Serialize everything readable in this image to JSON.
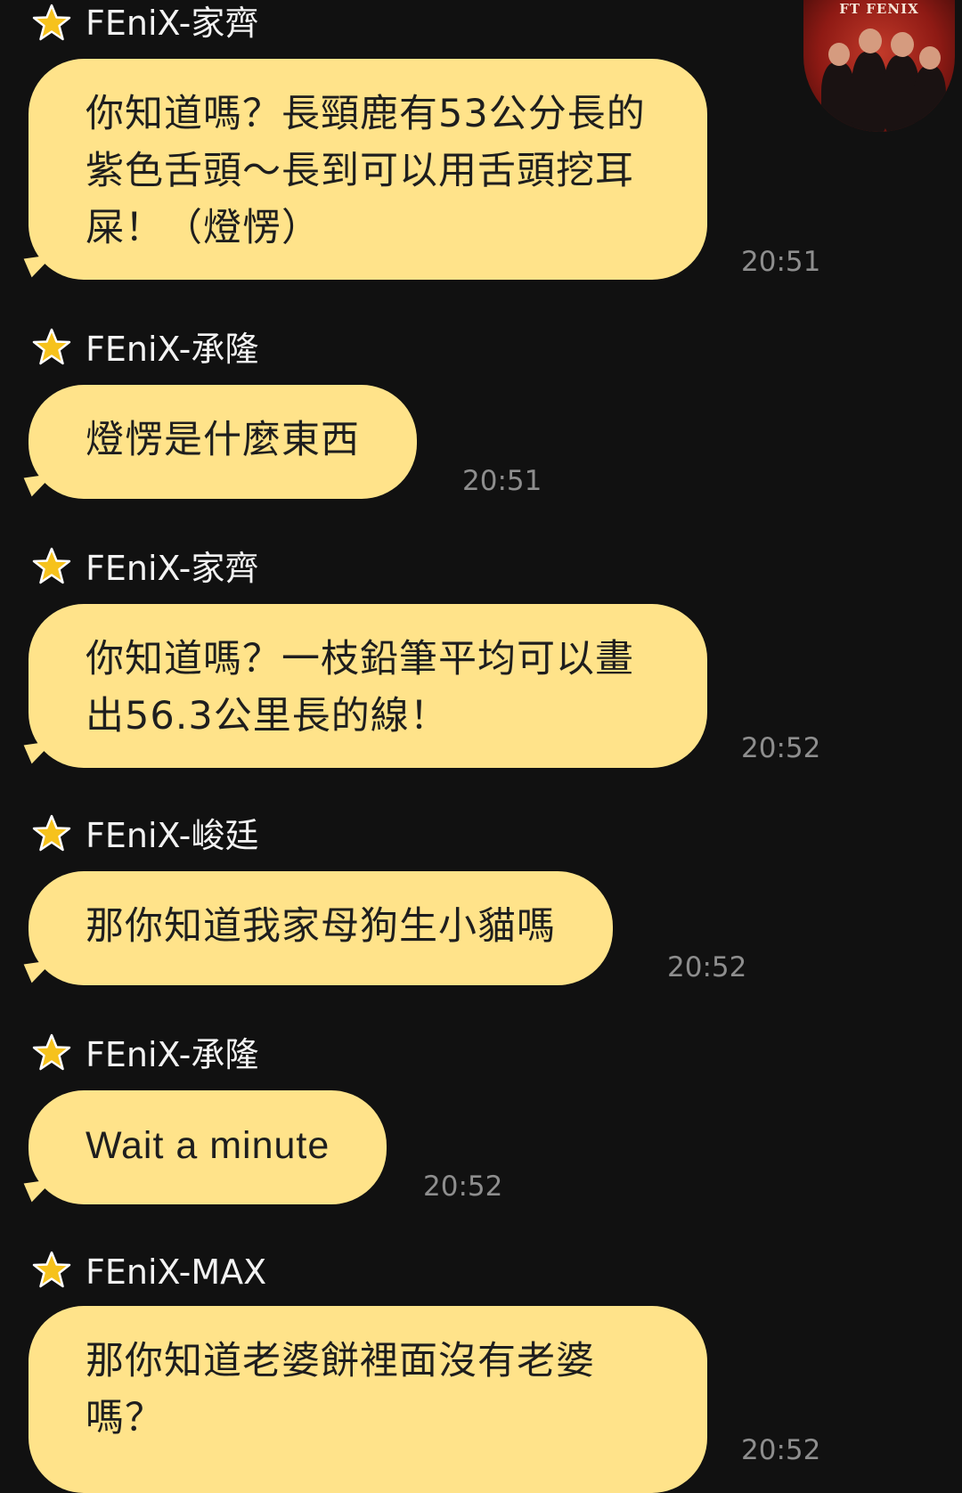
{
  "chat": {
    "avatar": {
      "label": "FT FENIX"
    },
    "messages": [
      {
        "sender": "FEniX-家齊",
        "badge_icon": "star-icon",
        "text": "你知道嗎？長頸鹿有53公分長的紫色舌頭～長到可以用舌頭挖耳屎！（燈愣）",
        "time": "20:51"
      },
      {
        "sender": "FEniX-承隆",
        "badge_icon": "star-icon",
        "text": "燈愣是什麼東西",
        "time": "20:51"
      },
      {
        "sender": "FEniX-家齊",
        "badge_icon": "star-icon",
        "text": "你知道嗎？一枝鉛筆平均可以畫出56.3公里長的線！",
        "time": "20:52"
      },
      {
        "sender": "FEniX-峻廷",
        "badge_icon": "star-icon",
        "text": "那你知道我家母狗生小貓嗎",
        "time": "20:52"
      },
      {
        "sender": "FEniX-承隆",
        "badge_icon": "star-icon",
        "text": "Wait a minute",
        "time": "20:52"
      },
      {
        "sender": "FEniX-MAX",
        "badge_icon": "star-icon",
        "text": "那你知道老婆餅裡面沒有老婆嗎？",
        "time": "20:52"
      }
    ]
  },
  "colors": {
    "background": "#111111",
    "bubble": "#ffe38a",
    "star": "#f6c21c",
    "sender_text": "#f2f2f2",
    "time_text": "#8e8e8e"
  }
}
